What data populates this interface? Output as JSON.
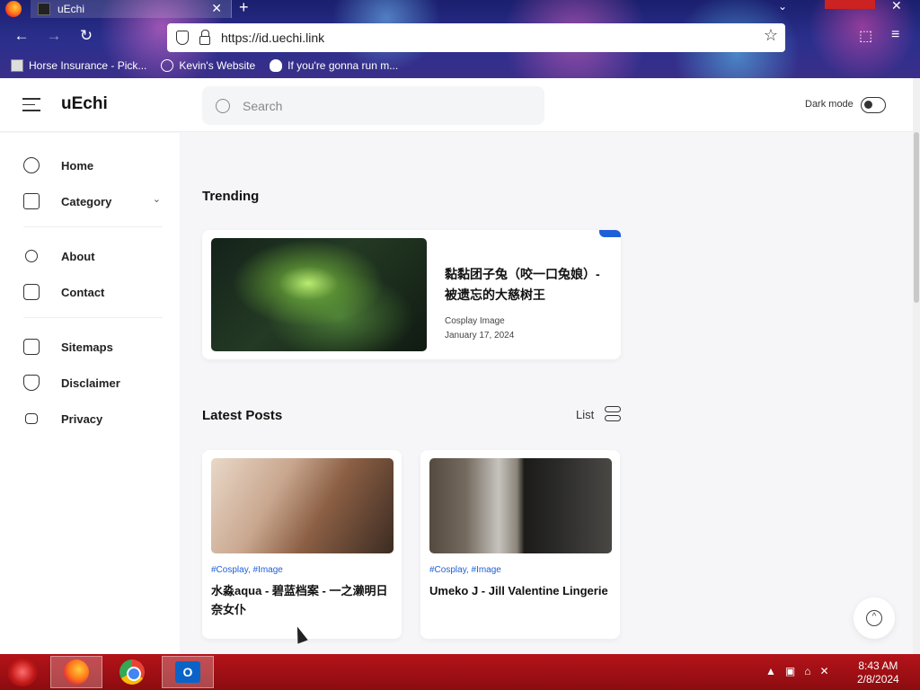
{
  "browser": {
    "tab_title": "uEchi",
    "url": "https://id.uechi.link",
    "bookmarks": [
      {
        "label": "Horse Insurance - Pick...",
        "icon": "image-icon"
      },
      {
        "label": "Kevin's Website",
        "icon": "globe-icon"
      },
      {
        "label": "If you're gonna run m...",
        "icon": "mask-icon"
      }
    ]
  },
  "site": {
    "brand": "uEchi",
    "search_placeholder": "Search",
    "dark_mode_label": "Dark mode"
  },
  "sidebar": {
    "items": [
      {
        "label": "Home",
        "icon": "home-icon"
      },
      {
        "label": "Category",
        "icon": "folder-icon"
      },
      {
        "label": "About",
        "icon": "user-icon"
      },
      {
        "label": "Contact",
        "icon": "mail-icon"
      },
      {
        "label": "Sitemaps",
        "icon": "document-icon"
      },
      {
        "label": "Disclaimer",
        "icon": "shield-icon"
      },
      {
        "label": "Privacy",
        "icon": "lock-icon"
      }
    ]
  },
  "trending": {
    "section_title": "Trending",
    "title": "黏黏团子兔（咬一口兔娘）- 被遗忘的大慈树王",
    "category": "Cosplay Image",
    "date": "January 17, 2024"
  },
  "latest": {
    "section_title": "Latest Posts",
    "view_label": "List",
    "posts": [
      {
        "tags": "#Cosplay, #Image",
        "title": "水淼aqua - 碧蓝档案 - 一之濑明日奈女仆"
      },
      {
        "tags": "#Cosplay, #Image",
        "title": "Umeko J - Jill Valentine Lingerie"
      }
    ]
  },
  "taskbar": {
    "time": "8:43 AM",
    "date": "2/8/2024"
  },
  "colors": {
    "accent": "#1e5fd8",
    "taskbar": "#b31319"
  }
}
